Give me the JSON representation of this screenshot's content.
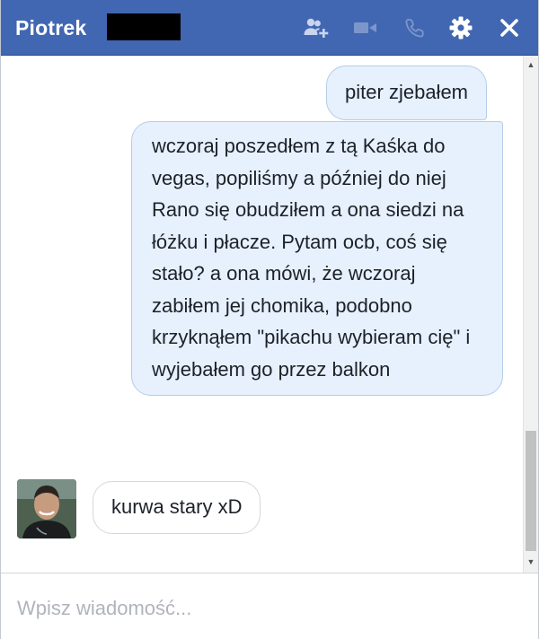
{
  "window": {
    "contact_name": "Piotrek",
    "icons": {
      "add_friend": "add-people-icon",
      "video_call": "video-camera-icon",
      "voice_call": "phone-icon",
      "settings": "gear-icon",
      "close": "close-icon"
    }
  },
  "messages": [
    {
      "direction": "outgoing",
      "text": "piter zjebałem"
    },
    {
      "direction": "outgoing",
      "text": "wczoraj poszedłem z tą Kaśka do vegas, popiliśmy a później do niej Rano się obudziłem a ona siedzi na łóżku i płacze. Pytam ocb, coś się stało? a ona mówi, że wczoraj zabiłem jej chomika, podobno krzyknąłem \"pikachu wybieram cię\" i wyjebałem go przez balkon"
    },
    {
      "direction": "incoming",
      "text": "kurwa stary xD"
    }
  ],
  "composer": {
    "placeholder": "Wpisz wiadomość...",
    "value": ""
  },
  "colors": {
    "titlebar": "#4267b2",
    "outgoing_bubble": "#e6f1fd",
    "incoming_bubble": "#ffffff"
  }
}
